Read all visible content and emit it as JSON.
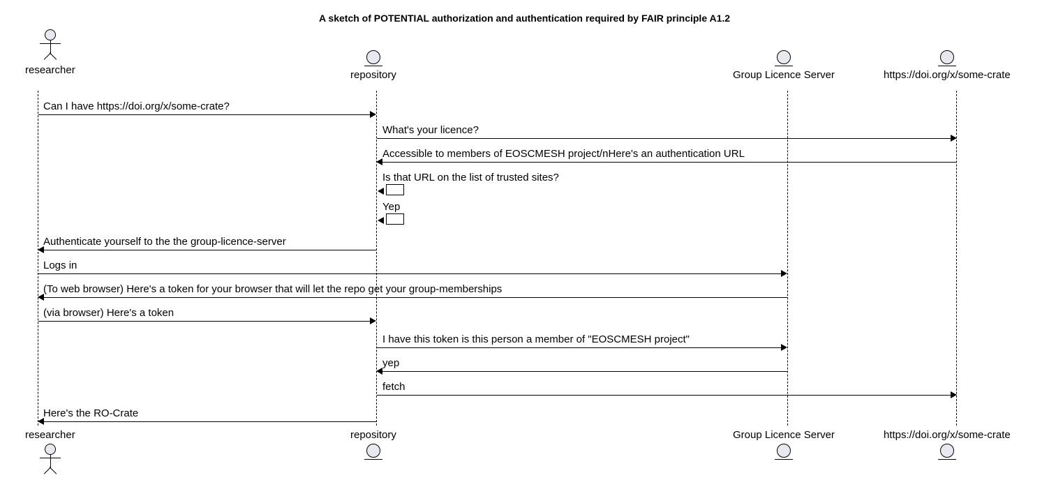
{
  "title": "A sketch of POTENTIAL authorization and authentication required by FAIR principle A1.2",
  "participants": {
    "researcher": "researcher",
    "repository": "repository",
    "gls": "Group Licence Server",
    "crate": "https://doi.org/x/some-crate"
  },
  "messages": {
    "m1": "Can I have https://doi.org/x/some-crate?",
    "m2": "What's your licence?",
    "m3": "Accessible to members of EOSCMESH project/nHere's an authentication URL",
    "m4": "Is that URL on the list of trusted sites?",
    "m5": "Yep",
    "m6": "Authenticate yourself to the the group-licence-server",
    "m7": "Logs in",
    "m8": "(To web browser) Here's a token for your browser that will let the repo get your group-memberships",
    "m9": "(via browser) Here's a token",
    "m10": "I have this token is this person a member of \"EOSCMESH project\"",
    "m11": "yep",
    "m12": "fetch",
    "m13": "Here's the RO-Crate"
  },
  "chart_data": {
    "type": "sequence-diagram",
    "participants": [
      {
        "id": "researcher",
        "kind": "actor",
        "label": "researcher"
      },
      {
        "id": "repository",
        "kind": "participant",
        "label": "repository"
      },
      {
        "id": "gls",
        "kind": "participant",
        "label": "Group Licence Server"
      },
      {
        "id": "crate",
        "kind": "participant",
        "label": "https://doi.org/x/some-crate"
      }
    ],
    "messages": [
      {
        "from": "researcher",
        "to": "repository",
        "text": "Can I have https://doi.org/x/some-crate?"
      },
      {
        "from": "repository",
        "to": "crate",
        "text": "What's your licence?"
      },
      {
        "from": "crate",
        "to": "repository",
        "text": "Accessible to members of EOSCMESH project/nHere's an authentication URL"
      },
      {
        "from": "repository",
        "to": "repository",
        "text": "Is that URL on the list of trusted sites?"
      },
      {
        "from": "repository",
        "to": "repository",
        "text": "Yep"
      },
      {
        "from": "repository",
        "to": "researcher",
        "text": "Authenticate yourself to the the group-licence-server"
      },
      {
        "from": "researcher",
        "to": "gls",
        "text": "Logs in"
      },
      {
        "from": "gls",
        "to": "researcher",
        "text": "(To web browser) Here's a token for your browser that will let the repo get your group-memberships"
      },
      {
        "from": "researcher",
        "to": "repository",
        "text": "(via browser) Here's a token"
      },
      {
        "from": "repository",
        "to": "gls",
        "text": "I have this token is this person a member of \"EOSCMESH project\""
      },
      {
        "from": "gls",
        "to": "repository",
        "text": "yep"
      },
      {
        "from": "repository",
        "to": "crate",
        "text": "fetch"
      },
      {
        "from": "repository",
        "to": "researcher",
        "text": "Here's the RO-Crate"
      }
    ]
  }
}
